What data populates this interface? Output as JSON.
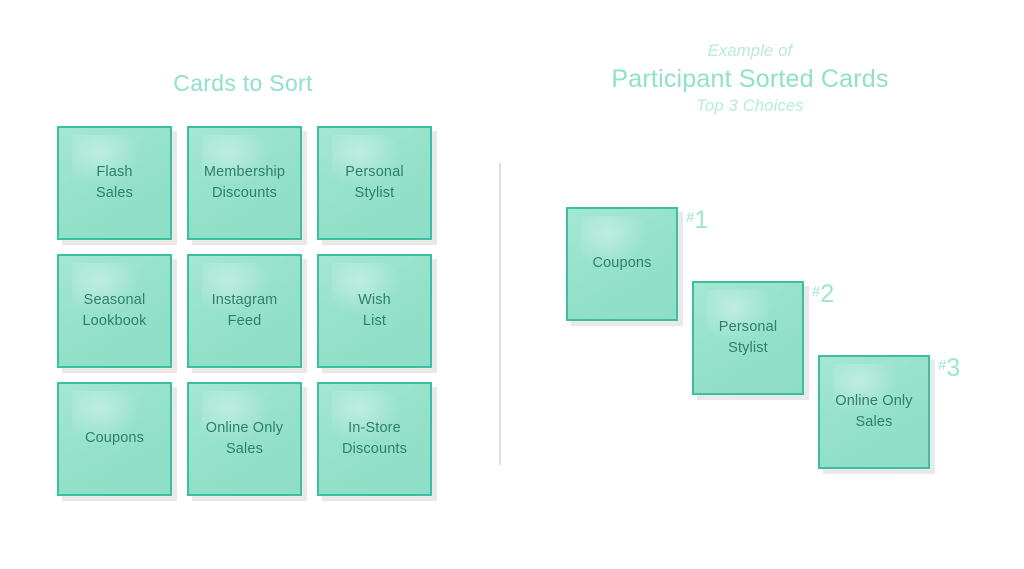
{
  "left": {
    "title": "Cards to Sort",
    "cards": [
      {
        "label": "Flash\nSales"
      },
      {
        "label": "Membership\nDiscounts"
      },
      {
        "label": "Personal\nStylist"
      },
      {
        "label": "Seasonal\nLookbook"
      },
      {
        "label": "Instagram\nFeed"
      },
      {
        "label": "Wish\nList"
      },
      {
        "label": "Coupons"
      },
      {
        "label": "Online Only\nSales"
      },
      {
        "label": "In-Store\nDiscounts"
      }
    ]
  },
  "right": {
    "eyebrow": "Example of",
    "title": "Participant Sorted Cards",
    "subtitle": "Top 3 Choices",
    "sorted": [
      {
        "label": "Coupons",
        "rank_hash": "#",
        "rank_number": "1"
      },
      {
        "label": "Personal\nStylist",
        "rank_hash": "#",
        "rank_number": "2"
      },
      {
        "label": "Online Only\nSales",
        "rank_hash": "#",
        "rank_number": "3"
      }
    ]
  },
  "colors": {
    "card_fill": "#9ce4ce",
    "card_border": "#3cbfa0",
    "card_text": "#2d7f6c",
    "heading": "#8fe1c9",
    "heading_light": "#b6ead9",
    "divider": "#dedede",
    "background": "#ffffff"
  }
}
